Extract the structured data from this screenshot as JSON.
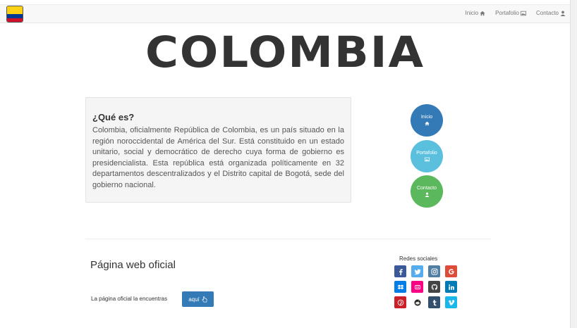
{
  "nav": {
    "links": [
      {
        "label": "Inicio",
        "icon": "home-icon"
      },
      {
        "label": "Portafolio",
        "icon": "image-icon"
      },
      {
        "label": "Contacto",
        "icon": "user-icon"
      }
    ]
  },
  "header": {
    "title": "COLOMBIA"
  },
  "info": {
    "heading": "¿Qué es?",
    "body": "Colombia, oficialmente República de Colombia, es un país situado en la región noroccidental de América del Sur. Está constituido en un estado unitario, social y democrático de derecho cuya forma de gobierno es presidencialista. Esta república está organizada políticamente en 32 departamentos descentralizados y el Distrito capital de Bogotá, sede del gobierno nacional."
  },
  "circles": [
    {
      "label": "Inicio",
      "icon": "home-icon",
      "color": "#337ab7"
    },
    {
      "label": "Portafolio",
      "icon": "image-icon",
      "color": "#5bc0de"
    },
    {
      "label": "Contacto",
      "icon": "user-icon",
      "color": "#5cb85c"
    }
  ],
  "web": {
    "title": "Página web oficial",
    "text": "La página oficial la encuentras",
    "button": "aquí"
  },
  "social": {
    "title": "Redes sociales",
    "items": [
      {
        "name": "facebook",
        "icon": "facebook-icon",
        "color": "#3b5998"
      },
      {
        "name": "twitter",
        "icon": "twitter-icon",
        "color": "#55acee"
      },
      {
        "name": "instagram",
        "icon": "instagram-icon",
        "color": "#517fa4"
      },
      {
        "name": "google",
        "icon": "google-icon",
        "color": "#dd4b39"
      },
      {
        "name": "dropbox",
        "icon": "dropbox-icon",
        "color": "#007ee5"
      },
      {
        "name": "flickr",
        "icon": "flickr-icon",
        "color": "#ff0084"
      },
      {
        "name": "github",
        "icon": "github-icon",
        "color": "#444444"
      },
      {
        "name": "linkedin",
        "icon": "linkedin-icon",
        "color": "#007bb6"
      },
      {
        "name": "pinterest",
        "icon": "pinterest-icon",
        "color": "#cb2027"
      },
      {
        "name": "reddit",
        "icon": "reddit-icon",
        "color": "#ffffff"
      },
      {
        "name": "tumblr",
        "icon": "tumblr-icon",
        "color": "#32506d"
      },
      {
        "name": "vimeo",
        "icon": "vimeo-icon",
        "color": "#1ab7ea"
      }
    ]
  }
}
